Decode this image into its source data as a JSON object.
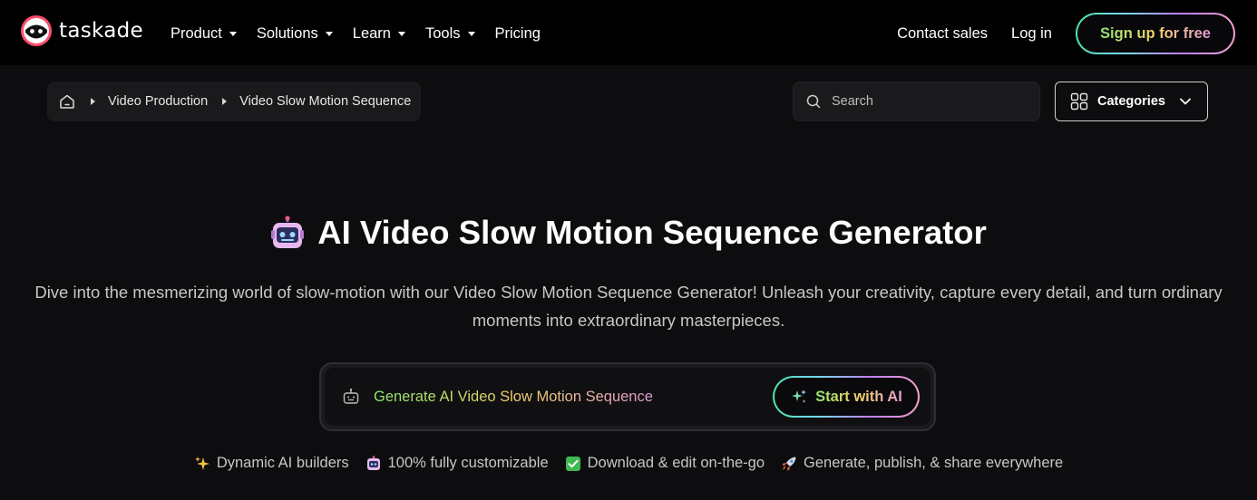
{
  "brand": {
    "name": "taskade"
  },
  "nav": {
    "items": [
      {
        "label": "Product",
        "has_caret": true
      },
      {
        "label": "Solutions",
        "has_caret": true
      },
      {
        "label": "Learn",
        "has_caret": true
      },
      {
        "label": "Tools",
        "has_caret": true
      },
      {
        "label": "Pricing",
        "has_caret": false
      }
    ],
    "contact_sales": "Contact sales",
    "login": "Log in",
    "signup": "Sign up for free"
  },
  "breadcrumb": {
    "home_icon": "home-icon",
    "items": [
      "Video Production",
      "Video Slow Motion Sequence"
    ]
  },
  "search": {
    "placeholder": "Search",
    "icon": "search-icon"
  },
  "categories": {
    "label": "Categories",
    "icon": "grid-icon"
  },
  "hero": {
    "emoji": "robot",
    "title": "AI Video Slow Motion Sequence Generator",
    "description": "Dive into the mesmerizing world of slow-motion with our Video Slow Motion Sequence Generator! Unleash your creativity, capture every detail, and turn ordinary moments into extraordinary masterpieces."
  },
  "generator": {
    "prompt": "Generate AI Video Slow Motion Sequence",
    "button": "Start with AI"
  },
  "features": [
    {
      "icon": "sparkles-icon",
      "label": "Dynamic AI builders"
    },
    {
      "icon": "robot-icon",
      "label": "100% fully customizable"
    },
    {
      "icon": "check-box-icon",
      "label": "Download & edit on-the-go"
    },
    {
      "icon": "rocket-icon",
      "label": "Generate, publish, & share everywhere"
    }
  ],
  "colors": {
    "background": "#0d0d0f",
    "nav_background": "#000000",
    "gradient_start": "#4ee0a6",
    "gradient_end": "#f0a0c8"
  }
}
